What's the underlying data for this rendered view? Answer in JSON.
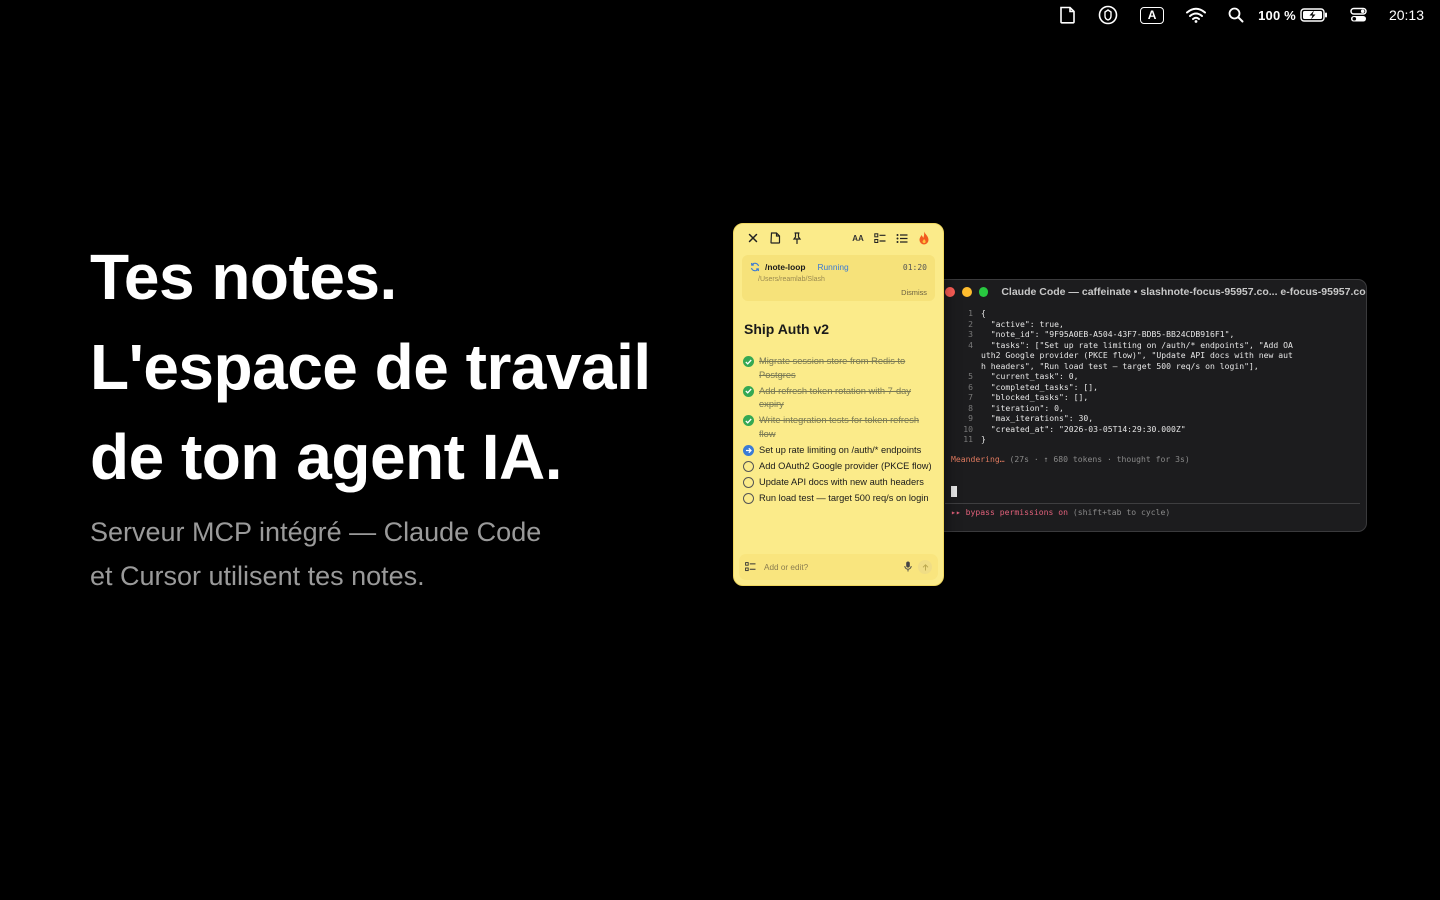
{
  "menubar": {
    "battery_text": "100 %",
    "keyboard_label": "A",
    "time": "20:13"
  },
  "hero": {
    "lines": [
      "Tes notes.",
      "L'espace de travail",
      "de ton agent IA."
    ],
    "subtitle_lines": [
      "Serveur MCP intégré — Claude Code",
      "et Cursor utilisent tes notes."
    ]
  },
  "terminal": {
    "title": "Claude Code — caffeinate • slashnote-focus-95957.co... e-focus-95957.co...",
    "code": [
      {
        "n": "1",
        "t": "{"
      },
      {
        "n": "2",
        "t": "  \"active\": true,"
      },
      {
        "n": "3",
        "t": "  \"note_id\": \"9F95A0EB-A504-43F7-BDB5-BB24CDB916F1\","
      },
      {
        "n": "4",
        "t": "  \"tasks\": [\"Set up rate limiting on /auth/* endpoints\", \"Add OA"
      },
      {
        "n": "",
        "t": "uth2 Google provider (PKCE flow)\", \"Update API docs with new aut"
      },
      {
        "n": "",
        "t": "h headers\", \"Run load test — target 500 req/s on login\"],"
      },
      {
        "n": "5",
        "t": "  \"current_task\": 0,"
      },
      {
        "n": "6",
        "t": "  \"completed_tasks\": [],"
      },
      {
        "n": "7",
        "t": "  \"blocked_tasks\": [],"
      },
      {
        "n": "8",
        "t": "  \"iteration\": 0,"
      },
      {
        "n": "9",
        "t": "  \"max_iterations\": 30,"
      },
      {
        "n": "10",
        "t": "  \"created_at\": \"2026-03-05T14:29:30.000Z\""
      },
      {
        "n": "11",
        "t": "}"
      }
    ],
    "status_meander": "Meandering…",
    "status_rest": " (27s · ↑ 680 tokens · thought for 3s)",
    "bypass_warn": "▸▸ bypass permissions on",
    "bypass_rest": " (shift+tab to cycle)"
  },
  "note": {
    "loop": {
      "name": "/note-loop",
      "status": "Running",
      "time": "01:20",
      "path": "/Users/reamlab/Slash",
      "dismiss": "Dismiss"
    },
    "font_size_label": "AA",
    "title": "Ship Auth v2",
    "tasks": [
      {
        "text": "Migrate session store from Redis to Postgres",
        "state": "done"
      },
      {
        "text": "Add refresh token rotation with 7-day expiry",
        "state": "done"
      },
      {
        "text": "Write integration tests for token refresh flow",
        "state": "done"
      },
      {
        "text": "Set up rate limiting on /auth/* endpoints",
        "state": "current"
      },
      {
        "text": "Add OAuth2 Google provider (PKCE flow)",
        "state": "open"
      },
      {
        "text": "Update API docs with new auth headers",
        "state": "open"
      },
      {
        "text": "Run load test — target 500 req/s on login",
        "state": "open"
      }
    ],
    "input_placeholder": "Add or edit?"
  },
  "colors": {
    "note_bg": "#fbeb8a",
    "running": "#3a7bd5",
    "done": "#34a853",
    "terminal_bg": "#1c1c1e"
  }
}
